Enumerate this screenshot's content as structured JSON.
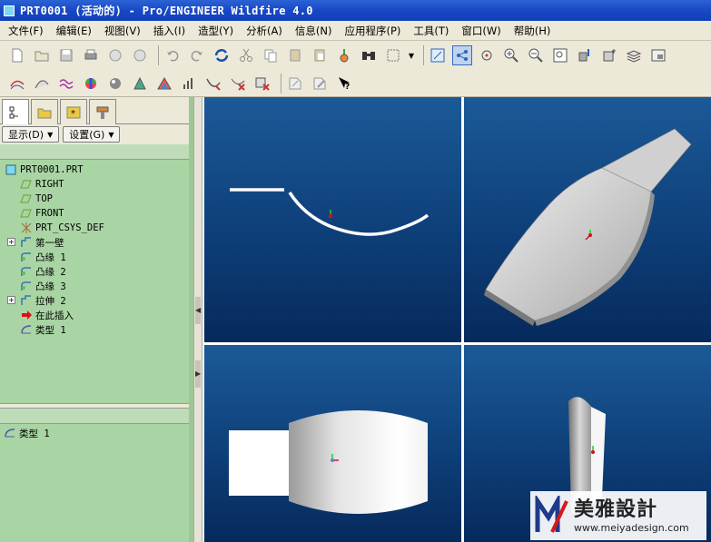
{
  "window": {
    "title": "PRT0001 (活动的) - Pro/ENGINEER Wildfire 4.0"
  },
  "menu": [
    "文件(F)",
    "编辑(E)",
    "视图(V)",
    "插入(I)",
    "造型(Y)",
    "分析(A)",
    "信息(N)",
    "应用程序(P)",
    "工具(T)",
    "窗口(W)",
    "帮助(H)"
  ],
  "left_panel": {
    "display_button": "显示(D)",
    "settings_button": "设置(G)",
    "tree": [
      {
        "label": "PRT0001.PRT",
        "icon": "part-icon"
      },
      {
        "label": "RIGHT",
        "icon": "datum-plane-icon"
      },
      {
        "label": "TOP",
        "icon": "datum-plane-icon"
      },
      {
        "label": "FRONT",
        "icon": "datum-plane-icon"
      },
      {
        "label": "PRT_CSYS_DEF",
        "icon": "csys-icon"
      },
      {
        "label": "第一壁",
        "icon": "wall-feature-icon"
      },
      {
        "label": "凸缘 1",
        "icon": "flange-icon"
      },
      {
        "label": "凸缘 2",
        "icon": "flange-icon"
      },
      {
        "label": "凸缘 3",
        "icon": "flange-icon"
      },
      {
        "label": "拉伸 2",
        "icon": "extrude-icon"
      },
      {
        "label": "在此插入",
        "icon": "insert-arrow-icon"
      },
      {
        "label": "类型 1",
        "icon": "sheetmetal-type-icon"
      }
    ],
    "lower_list": [
      {
        "label": "类型 1",
        "icon": "sheetmetal-type-icon"
      }
    ]
  },
  "watermark": {
    "chinese": "美雅設計",
    "url": "www.meiyadesign.com"
  },
  "colors": {
    "viewport_top": "#1b5a97",
    "viewport_bottom": "#062a5c",
    "panel_green": "#a9d5a4"
  }
}
